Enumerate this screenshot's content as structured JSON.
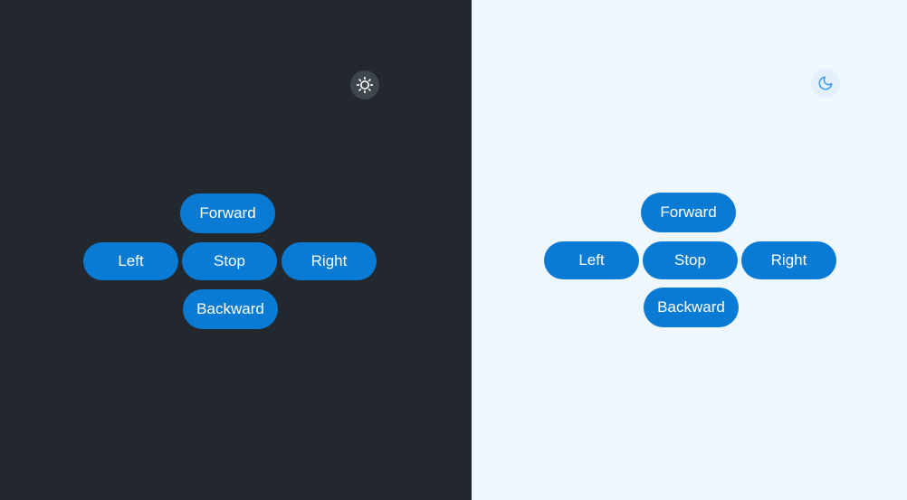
{
  "colors": {
    "dark_background": "#22282e",
    "light_background": "#eef7fe",
    "button_blue": "#0a7bd4",
    "button_text": "#ffffff",
    "dark_toggle_bg": "#3e454d",
    "light_toggle_bg": "#e3f0fb",
    "moon_icon": "#3a9bf0"
  },
  "dark_panel": {
    "theme_toggle_icon": "sun-icon",
    "controls": {
      "forward": "Forward",
      "left": "Left",
      "stop": "Stop",
      "right": "Right",
      "backward": "Backward"
    }
  },
  "light_panel": {
    "theme_toggle_icon": "moon-icon",
    "controls": {
      "forward": "Forward",
      "left": "Left",
      "stop": "Stop",
      "right": "Right",
      "backward": "Backward"
    }
  }
}
